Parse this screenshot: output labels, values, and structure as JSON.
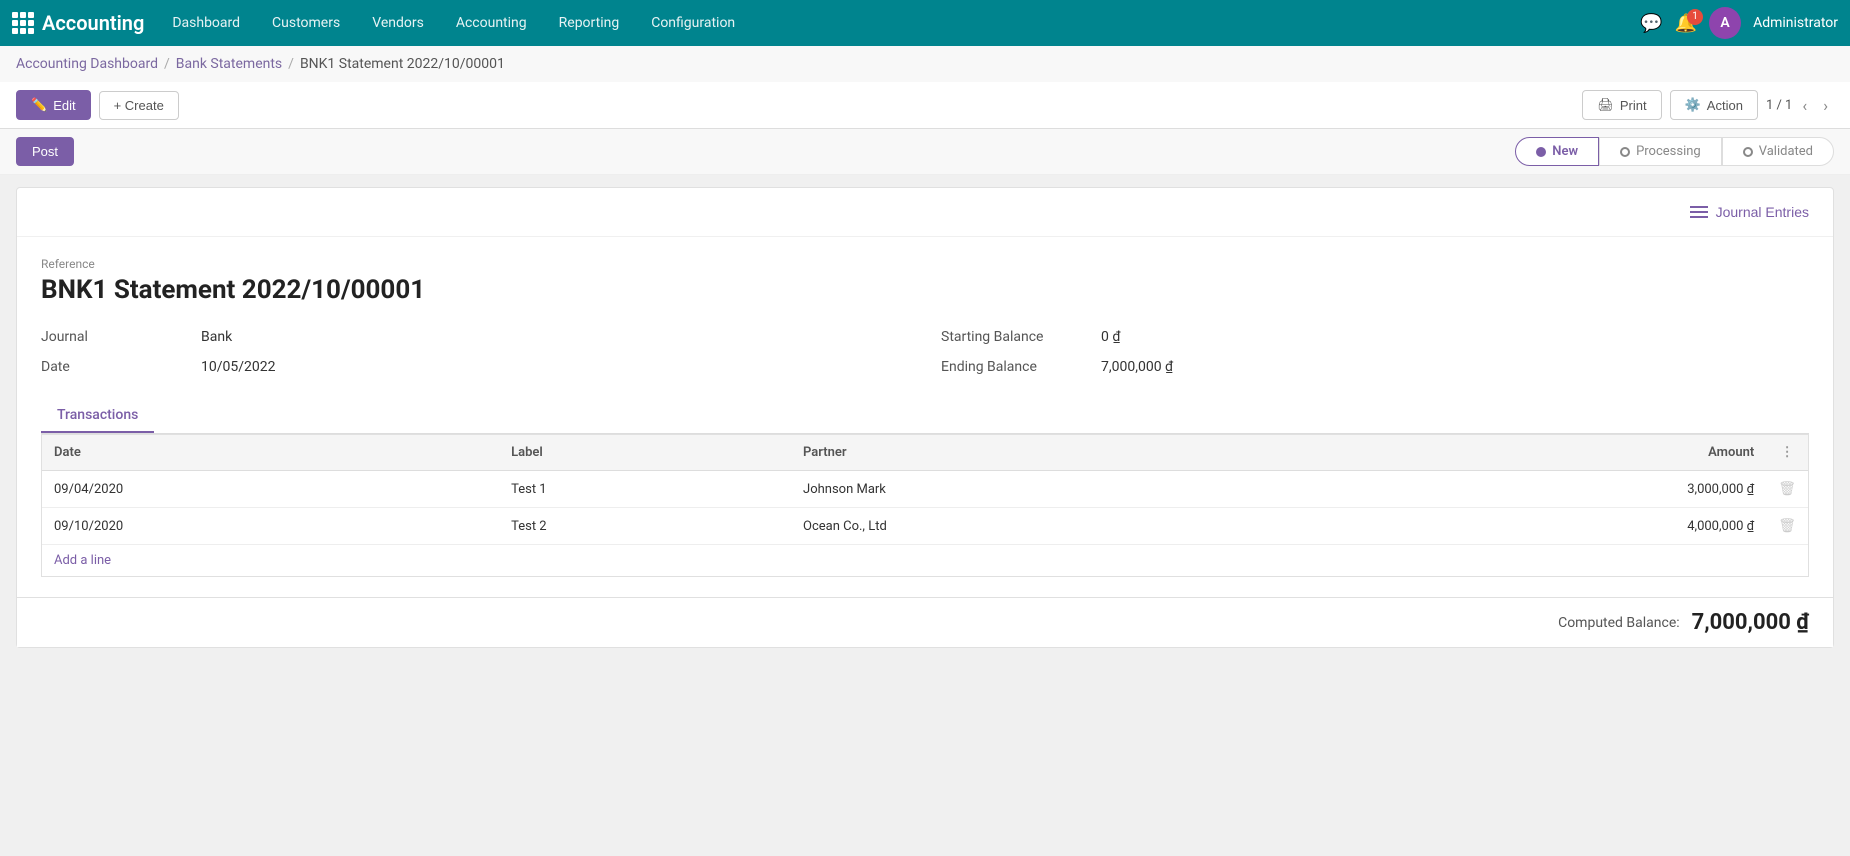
{
  "app": {
    "name": "Accounting",
    "logo_letter": "A"
  },
  "nav": {
    "items": [
      {
        "label": "Dashboard",
        "id": "dashboard"
      },
      {
        "label": "Customers",
        "id": "customers"
      },
      {
        "label": "Vendors",
        "id": "vendors"
      },
      {
        "label": "Accounting",
        "id": "accounting"
      },
      {
        "label": "Reporting",
        "id": "reporting"
      },
      {
        "label": "Configuration",
        "id": "configuration"
      }
    ]
  },
  "topnav_right": {
    "chat_icon": "💬",
    "bell_count": "1",
    "admin_initial": "A",
    "admin_name": "Administrator"
  },
  "breadcrumb": {
    "parts": [
      {
        "label": "Accounting Dashboard",
        "id": "accounting-dashboard"
      },
      {
        "label": "Bank Statements",
        "id": "bank-statements"
      },
      {
        "label": "BNK1 Statement 2022/10/00001",
        "id": "current"
      }
    ]
  },
  "toolbar": {
    "edit_label": "Edit",
    "create_label": "+ Create",
    "print_label": "Print",
    "action_label": "Action",
    "nav_count": "1 / 1"
  },
  "status": {
    "post_label": "Post",
    "steps": [
      {
        "label": "New",
        "active": true
      },
      {
        "label": "Processing",
        "active": false
      },
      {
        "label": "Validated",
        "active": false
      }
    ]
  },
  "record": {
    "reference_label": "Reference",
    "title": "BNK1 Statement 2022/10/00001",
    "journal_label": "Journal",
    "journal_value": "Bank",
    "date_label": "Date",
    "date_value": "10/05/2022",
    "starting_balance_label": "Starting Balance",
    "starting_balance_value": "0 ₫",
    "ending_balance_label": "Ending Balance",
    "ending_balance_value": "7,000,000 ₫"
  },
  "journal_entries_btn": "Journal Entries",
  "tabs": [
    {
      "label": "Transactions",
      "active": true
    }
  ],
  "table": {
    "columns": [
      {
        "label": "Date",
        "id": "date"
      },
      {
        "label": "Label",
        "id": "label"
      },
      {
        "label": "Partner",
        "id": "partner"
      },
      {
        "label": "Amount",
        "id": "amount"
      }
    ],
    "rows": [
      {
        "date": "09/04/2020",
        "label": "Test 1",
        "partner": "Johnson Mark",
        "amount": "3,000,000 ₫"
      },
      {
        "date": "09/10/2020",
        "label": "Test 2",
        "partner": "Ocean Co., Ltd",
        "amount": "4,000,000 ₫"
      }
    ],
    "add_line_label": "Add a line"
  },
  "footer": {
    "computed_label": "Computed Balance:",
    "computed_value": "7,000,000 ₫"
  }
}
